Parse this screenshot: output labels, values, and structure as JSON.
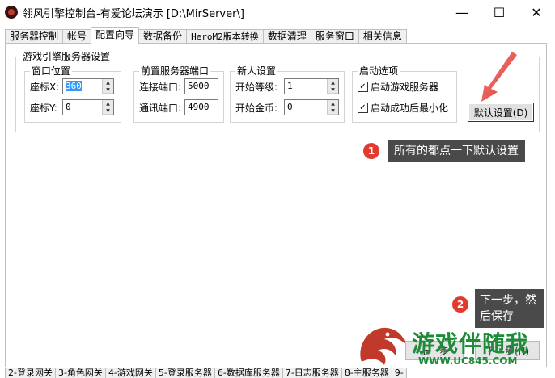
{
  "window": {
    "title": "翎风引擎控制台-有爱论坛演示 [D:\\MirServer\\]",
    "minimize": "—",
    "maximize": "☐",
    "close": "✕"
  },
  "tabs": [
    {
      "label": "服务器控制"
    },
    {
      "label": "帐号"
    },
    {
      "label": "配置向导"
    },
    {
      "label": "数据备份"
    },
    {
      "label": "HeroM2版本转换"
    },
    {
      "label": "数据清理"
    },
    {
      "label": "服务窗口"
    },
    {
      "label": "相关信息"
    }
  ],
  "engine_group": {
    "title": "游戏引擎服务器设置",
    "window_pos": {
      "title": "窗口位置",
      "x_label": "座标X:",
      "x_value": "360",
      "y_label": "座标Y:",
      "y_value": "0"
    },
    "front_ports": {
      "title": "前置服务器端口",
      "connect_label": "连接端口:",
      "connect_value": "5000",
      "comm_label": "通讯端口:",
      "comm_value": "4900"
    },
    "newbie": {
      "title": "新人设置",
      "level_label": "开始等级:",
      "level_value": "1",
      "gold_label": "开始金币:",
      "gold_value": "0"
    },
    "startup": {
      "title": "启动选项",
      "opt1": "启动游戏服务器",
      "opt2": "启动成功后最小化"
    },
    "default_button": "默认设置(D)"
  },
  "annotations": {
    "badge1": "1",
    "callout1": "所有的都点一下默认设置",
    "badge2": "2",
    "callout2_line1": "下一步，然",
    "callout2_line2": "后保存"
  },
  "hidden_buttons": {
    "next": "下一步(N)",
    "prev": "上一步"
  },
  "watermark": {
    "title": "游戏伴随我",
    "url": "WWW.UC845.COM"
  },
  "bottom_tabs": [
    {
      "label": "2-登录网关"
    },
    {
      "label": "3-角色网关"
    },
    {
      "label": "4-游戏网关"
    },
    {
      "label": "5-登录服务器"
    },
    {
      "label": "6-数据库服务器"
    },
    {
      "label": "7-日志服务器"
    },
    {
      "label": "8-主服务器"
    },
    {
      "label": "9-"
    }
  ],
  "colors": {
    "accent_red": "#e23a2f",
    "callout_bg": "#4a4a4a",
    "watermark_green": "#1f8a3a",
    "watermark_red": "#c0392b"
  }
}
